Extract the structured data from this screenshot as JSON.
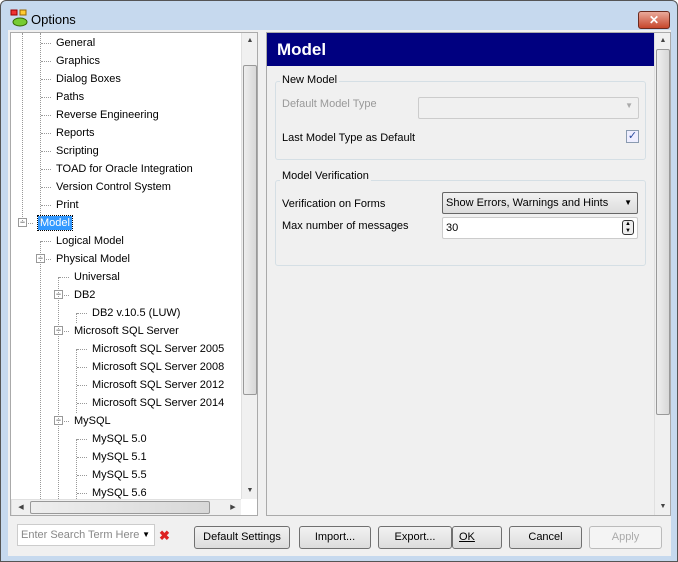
{
  "window": {
    "title": "Options",
    "close_label": "✕"
  },
  "tree": [
    {
      "label": "General",
      "level": 1
    },
    {
      "label": "Graphics",
      "level": 1
    },
    {
      "label": "Dialog Boxes",
      "level": 1
    },
    {
      "label": "Paths",
      "level": 1
    },
    {
      "label": "Reverse Engineering",
      "level": 1
    },
    {
      "label": "Reports",
      "level": 1
    },
    {
      "label": "Scripting",
      "level": 1
    },
    {
      "label": "TOAD for Oracle Integration",
      "level": 1
    },
    {
      "label": "Version Control System",
      "level": 1
    },
    {
      "label": "Print",
      "level": 1
    },
    {
      "label": "Model",
      "level": 0,
      "expanded": true,
      "selected": true
    },
    {
      "label": "Logical Model",
      "level": 1
    },
    {
      "label": "Physical Model",
      "level": 1,
      "expanded": true
    },
    {
      "label": "Universal",
      "level": 2
    },
    {
      "label": "DB2",
      "level": 2,
      "expanded": true
    },
    {
      "label": "DB2 v.10.5 (LUW)",
      "level": 3
    },
    {
      "label": "Microsoft SQL Server",
      "level": 2,
      "expanded": true
    },
    {
      "label": "Microsoft SQL Server 2005",
      "level": 3
    },
    {
      "label": "Microsoft SQL Server 2008",
      "level": 3
    },
    {
      "label": "Microsoft SQL Server 2012",
      "level": 3
    },
    {
      "label": "Microsoft SQL Server 2014",
      "level": 3
    },
    {
      "label": "MySQL",
      "level": 2,
      "expanded": true
    },
    {
      "label": "MySQL 5.0",
      "level": 3
    },
    {
      "label": "MySQL 5.1",
      "level": 3
    },
    {
      "label": "MySQL 5.5",
      "level": 3
    },
    {
      "label": "MySQL 5.6",
      "level": 3
    }
  ],
  "panel": {
    "title": "Model",
    "new_model": {
      "group_title": "New Model",
      "default_type_label": "Default Model Type",
      "default_type_value": "",
      "last_type_label": "Last Model Type as Default",
      "last_type_checked": true
    },
    "verification": {
      "group_title": "Model Verification",
      "forms_label": "Verification on Forms",
      "forms_value": "Show Errors, Warnings and Hints",
      "max_label": "Max number of messages",
      "max_value": "30"
    }
  },
  "footer": {
    "search_placeholder": "Enter Search Term Here",
    "default_settings": "Default Settings",
    "import": "Import...",
    "export": "Export...",
    "ok": "OK",
    "cancel": "Cancel",
    "apply": "Apply"
  }
}
